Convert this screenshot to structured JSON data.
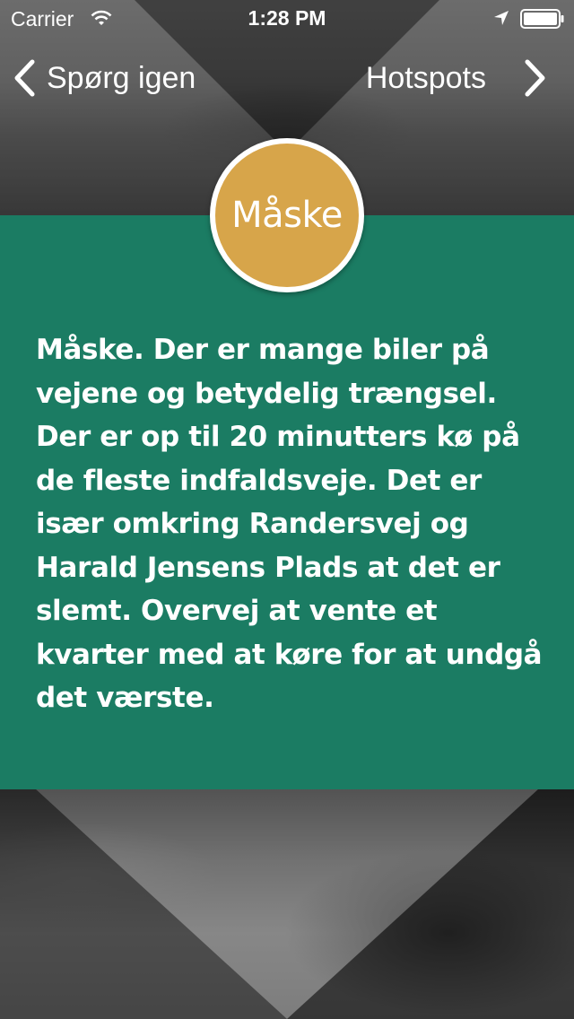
{
  "status_bar": {
    "carrier": "Carrier",
    "time": "1:28 PM"
  },
  "nav": {
    "back_label": "Spørg igen",
    "forward_label": "Hotspots"
  },
  "badge": {
    "label": "Måske",
    "color": "#d7a54a"
  },
  "answer": {
    "text": "Måske. Der er mange biler på vejene og betydelig trængsel. Der er op til 20 minutters kø på de fleste indfaldsveje. Det er især omkring Randersvej og Harald Jensens Plads at det er slemt. Overvej at vente et kvarter med at køre for at undgå det værste."
  },
  "colors": {
    "panel": "#1b7c63",
    "text": "#ffffff"
  },
  "icons": {
    "status": [
      "wifi-icon",
      "location-icon",
      "battery-icon"
    ],
    "nav": [
      "chevron-left-icon",
      "chevron-right-icon"
    ]
  }
}
